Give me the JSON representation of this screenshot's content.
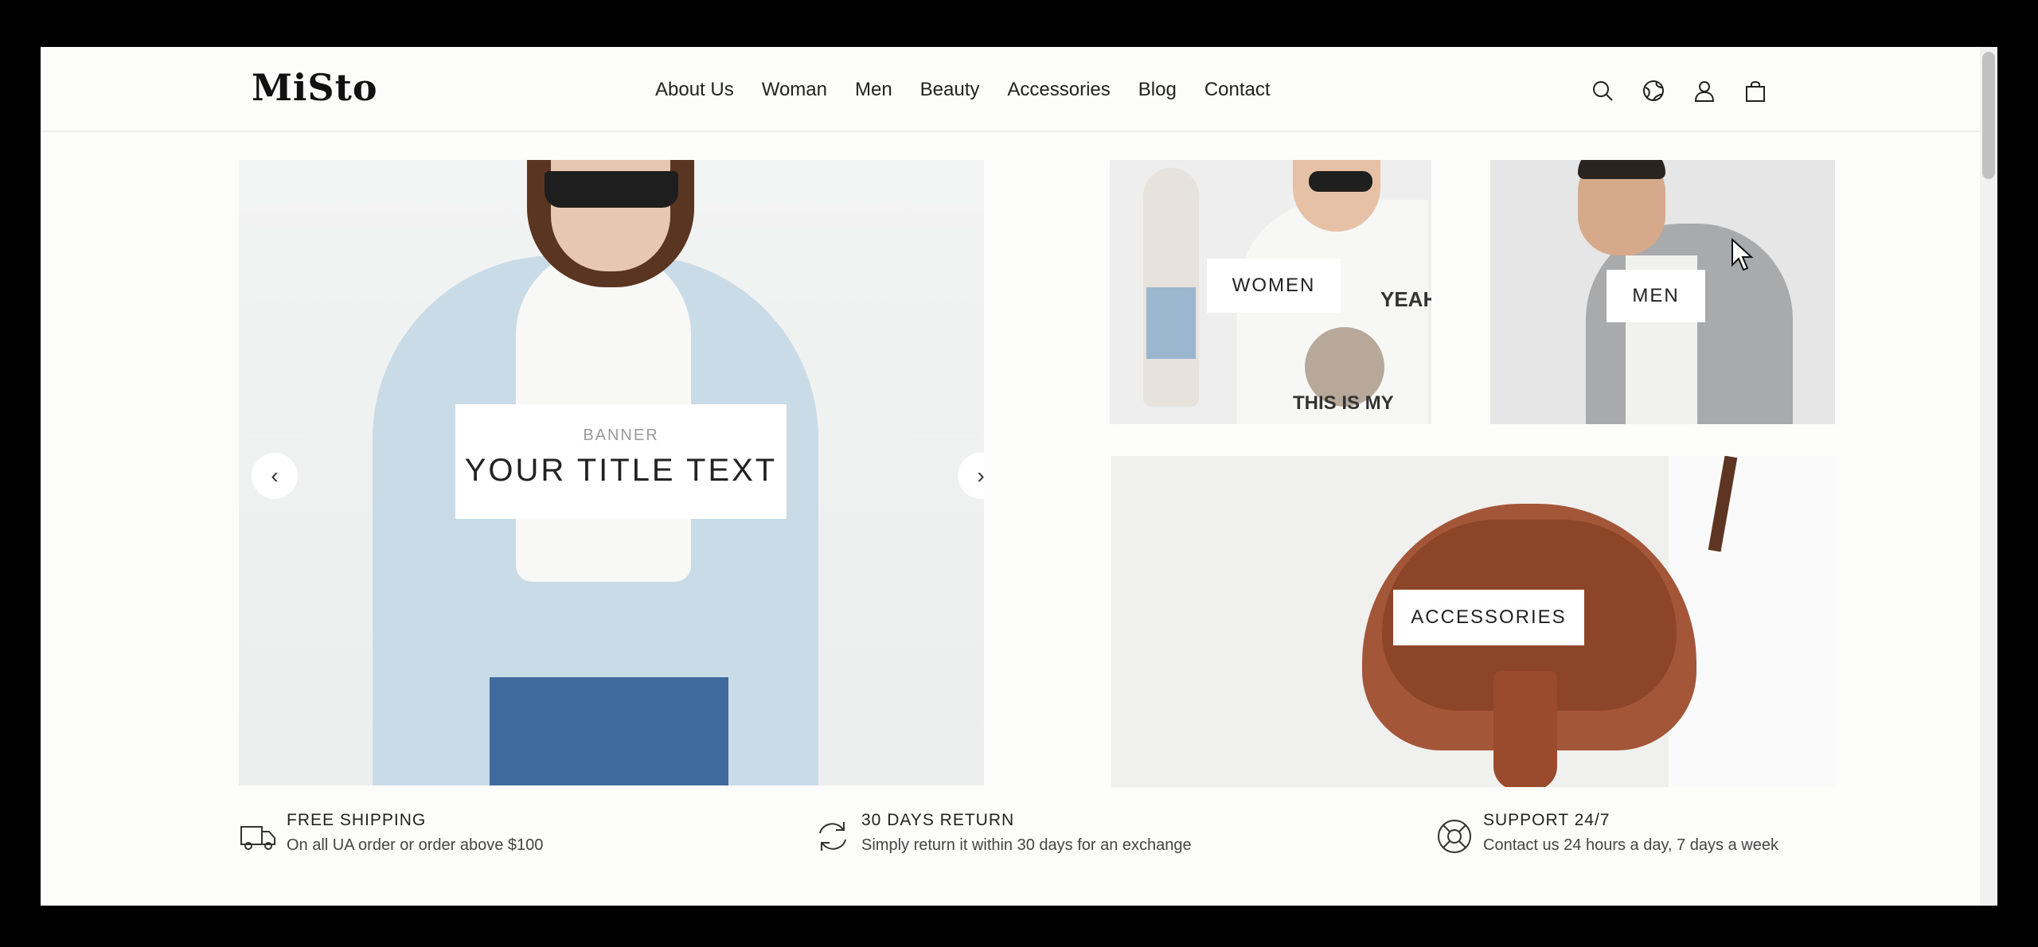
{
  "header": {
    "logo": "MiSto",
    "nav": [
      "About Us",
      "Woman",
      "Men",
      "Beauty",
      "Accessories",
      "Blog",
      "Contact"
    ],
    "icons": [
      "search-icon",
      "globe-icon",
      "user-icon",
      "cart-icon"
    ]
  },
  "banner": {
    "kicker": "BANNER",
    "title": "YOUR TITLE TEXT",
    "prev_label": "‹",
    "next_label": "›"
  },
  "categories": {
    "women": "WOMEN",
    "men": "MEN",
    "accessories": "ACCESSORIES",
    "women_tshirt_text_1": "YEAH...",
    "women_tshirt_text_2": "THIS IS MY"
  },
  "features": [
    {
      "icon": "truck-icon",
      "title": "FREE SHIPPING",
      "subtitle": "On all UA order or order above $100"
    },
    {
      "icon": "refresh-icon",
      "title": "30 DAYS RETURN",
      "subtitle": "Simply return it within 30 days for an exchange"
    },
    {
      "icon": "lifebuoy-icon",
      "title": "SUPPORT 24/7",
      "subtitle": "Contact us 24 hours a day, 7 days a week"
    }
  ],
  "colors": {
    "page_bg": "#fcfcfb",
    "frame_bg": "#000000",
    "text": "#222222",
    "jacket": "#c9dbe6",
    "bag": "#a35638"
  }
}
